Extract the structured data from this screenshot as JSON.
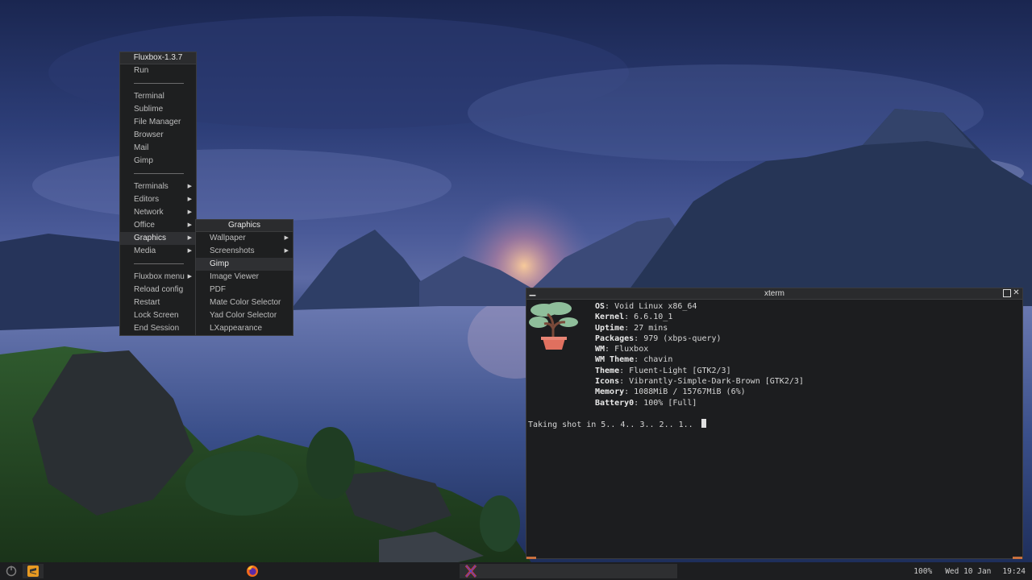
{
  "main_menu": {
    "title": "Fluxbox-1.3.7",
    "items": [
      {
        "label": "Run",
        "type": "item"
      },
      {
        "type": "sep"
      },
      {
        "label": "Terminal",
        "type": "item"
      },
      {
        "label": "Sublime",
        "type": "item"
      },
      {
        "label": "File Manager",
        "type": "item"
      },
      {
        "label": "Browser",
        "type": "item"
      },
      {
        "label": "Mail",
        "type": "item"
      },
      {
        "label": "Gimp",
        "type": "item"
      },
      {
        "type": "sep"
      },
      {
        "label": "Terminals",
        "type": "submenu"
      },
      {
        "label": "Editors",
        "type": "submenu"
      },
      {
        "label": "Network",
        "type": "submenu"
      },
      {
        "label": "Office",
        "type": "submenu"
      },
      {
        "label": "Graphics",
        "type": "submenu",
        "selected": true
      },
      {
        "label": "Media",
        "type": "submenu"
      },
      {
        "type": "sep"
      },
      {
        "label": "Fluxbox menu",
        "type": "submenu"
      },
      {
        "label": "Reload config",
        "type": "item"
      },
      {
        "label": "Restart",
        "type": "item"
      },
      {
        "label": "Lock Screen",
        "type": "item"
      },
      {
        "label": "End Session",
        "type": "item"
      }
    ]
  },
  "graphics_menu": {
    "title": "Graphics",
    "items": [
      {
        "label": "Wallpaper",
        "type": "submenu"
      },
      {
        "label": "Screenshots",
        "type": "submenu"
      },
      {
        "label": "Gimp",
        "type": "item",
        "selected": true
      },
      {
        "label": "Image Viewer",
        "type": "item"
      },
      {
        "label": "PDF",
        "type": "item"
      },
      {
        "label": "Mate Color Selector",
        "type": "item"
      },
      {
        "label": "Yad Color Selector",
        "type": "item"
      },
      {
        "label": "LXappearance",
        "type": "item"
      }
    ]
  },
  "xterm": {
    "title": "xterm",
    "info": [
      {
        "key": "OS",
        "value": "Void Linux x86_64"
      },
      {
        "key": "Kernel",
        "value": "6.6.10_1"
      },
      {
        "key": "Uptime",
        "value": "27 mins"
      },
      {
        "key": "Packages",
        "value": "979 (xbps-query)"
      },
      {
        "key": "WM",
        "value": "Fluxbox"
      },
      {
        "key": "WM Theme",
        "value": "chavin"
      },
      {
        "key": "Theme",
        "value": "Fluent-Light [GTK2/3]"
      },
      {
        "key": "Icons",
        "value": "Vibrantly-Simple-Dark-Brown [GTK2/3]"
      },
      {
        "key": "Memory",
        "value": "1088MiB / 15767MiB (6%)"
      },
      {
        "key": "Battery0",
        "value": "100% [Full]"
      }
    ],
    "prompt_line": "Taking shot in 5.. 4.. 3.. 2.. 1.. "
  },
  "taskbar": {
    "volume": "100%",
    "date": "Wed 10 Jan",
    "time": "19:24",
    "icons": [
      "power-icon",
      "sublime-icon",
      "firefox-icon",
      "xterm-icon"
    ]
  },
  "colors": {
    "menu_bg": "#1e1f20",
    "terminal_bg": "#1c1d1f",
    "accent": "#c8703e",
    "taskbar_bg": "#1d1e20"
  }
}
